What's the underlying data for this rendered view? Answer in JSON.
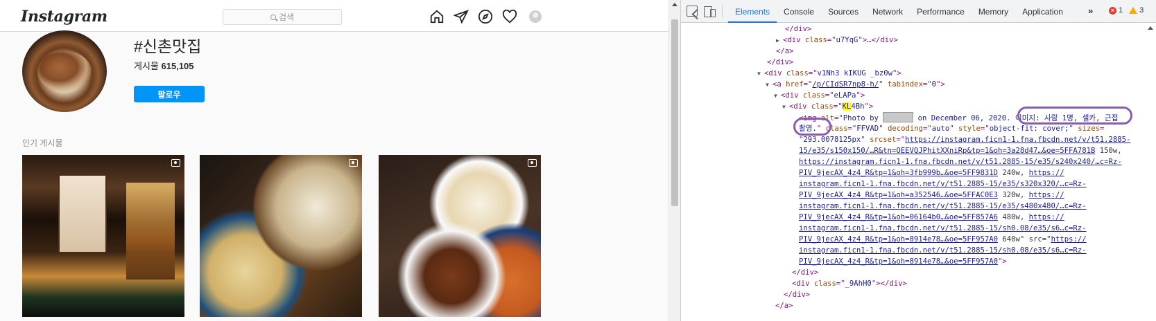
{
  "instagram": {
    "logo": "Instagram",
    "search_placeholder": "검색",
    "hashtag": "#신촌맛집",
    "posts_label": "게시물",
    "posts_count": "615,105",
    "follow_label": "팔로우",
    "popular_label": "인기 게시물",
    "nav_icons": [
      "home-icon",
      "direct-icon",
      "explore-icon",
      "heart-icon",
      "profile-avatar"
    ]
  },
  "devtools": {
    "tabs": [
      "Elements",
      "Console",
      "Sources",
      "Network",
      "Performance",
      "Memory",
      "Application"
    ],
    "active_tab": "Elements",
    "more": "»",
    "error_count": "1",
    "warning_count": "3",
    "code": {
      "l1": "</div>",
      "l2_open": "<div class=\"",
      "l2_cls": "u7YqG",
      "l2_close": "\">…</div>",
      "l3": "</a>",
      "l4": "</div>",
      "l5_cls": "v1Nh3 kIKUG  _bz0w",
      "l6_href": "/p/CIdSR7np8-h/",
      "l6_tabindex": "0",
      "l7_cls": "eLAPa",
      "l8_cls_hl": "KL",
      "l8_cls_rest": "4Bh",
      "l9_alt_a": "Photo by ",
      "l9_alt_b": " on December 06, 2020. ",
      "l9_alt_c": "이미지: 사람 1명, 셀카, 근접",
      "l10_alt_d": "촬영.",
      "l10_class": "FFVAD",
      "l10_decoding": "auto",
      "l10_style": "object-fit: cover;",
      "l10_sizes": "293.0078125px",
      "srcset_1": "https://instagram.ficn1-1.fna.fbcdn.net/v/t51.2885-",
      "srcset_2": "15/e35/s150x150/…R&tn=OEEVQJPhitXXniRp&tp=1&oh=3a28d47…&oe=5FFA781B",
      "srcset_2b": " 150w,",
      "srcset_3": "https://instagram.ficn1-1.fna.fbcdn.net/v/t51.2885-15/e35/s240x240/…c=Rz-",
      "srcset_4": "PIV_9jecAX_4z4_R&tp=1&oh=3fb999b…&oe=5FF9831D",
      "srcset_4b": " 240w, ",
      "srcset_4c": "https://",
      "srcset_5": "instagram.ficn1-1.fna.fbcdn.net/v/t51.2885-15/e35/s320x320/…c=Rz-",
      "srcset_6": "PIV_9jecAX_4z4_R&tp=1&oh=a352546…&oe=5FFAC0E3",
      "srcset_6b": " 320w, ",
      "srcset_6c": "https://",
      "srcset_7": "instagram.ficn1-1.fna.fbcdn.net/v/t51.2885-15/e35/s480x480/…c=Rz-",
      "srcset_8": "PIV_9jecAX_4z4_R&tp=1&oh=06164b0…&oe=5FF857A6",
      "srcset_8b": " 480w, ",
      "srcset_8c": "https://",
      "srcset_9": "instagram.ficn1-1.fna.fbcdn.net/v/t51.2885-15/sh0.08/e35/s6…c=Rz-",
      "srcset_10": "PIV_9jecAX_4z4_R&tp=1&oh=8914e78…&oe=5FF957A0",
      "srcset_10b": " 640w\" src=\"",
      "srcset_10c": "https://",
      "src_11": "instagram.ficn1-1.fna.fbcdn.net/v/t51.2885-15/sh0.08/e35/s6…c=Rz-",
      "src_12": "PIV_9jecAX_4z4_R&tp=1&oh=8914e78…&oe=5FF957A0",
      "l13": "</div>",
      "l14_cls": "_9AhH0",
      "l15": "</div>",
      "l16": "</a>"
    }
  }
}
